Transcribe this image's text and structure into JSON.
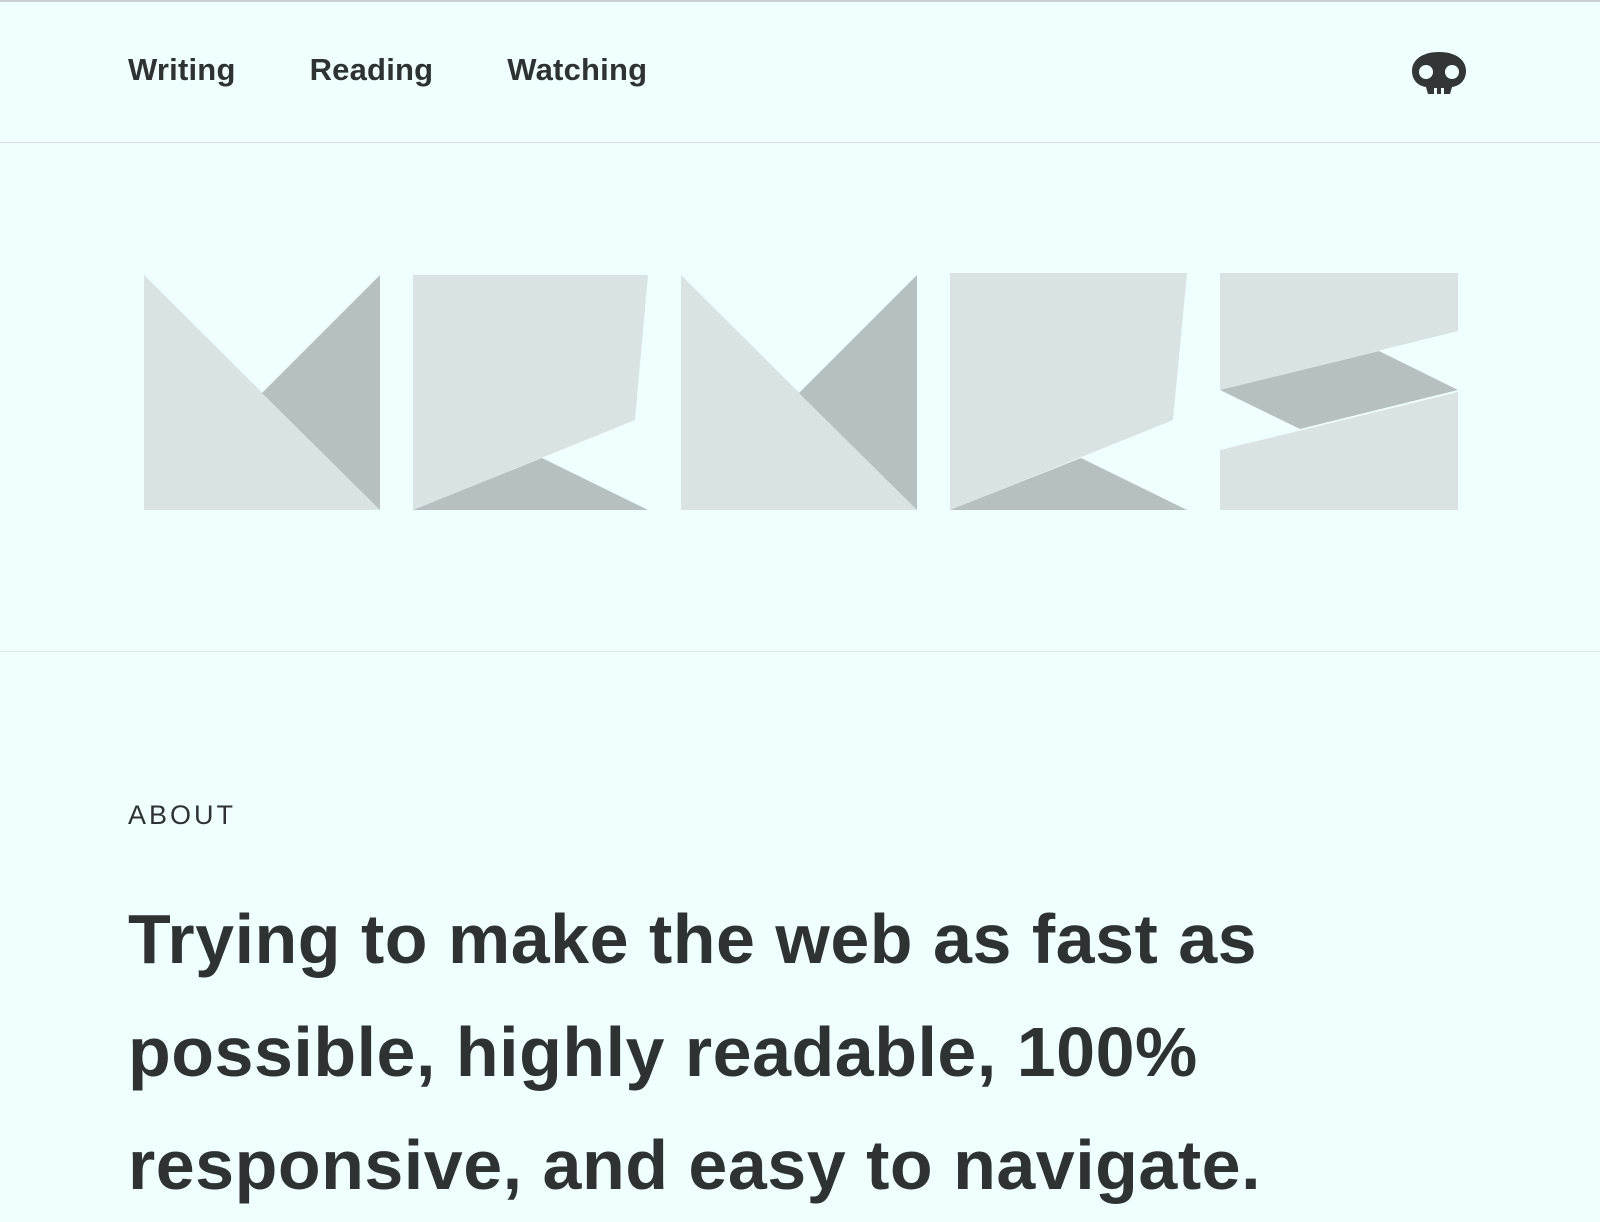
{
  "nav": {
    "links": [
      {
        "label": "Writing"
      },
      {
        "label": "Reading"
      },
      {
        "label": "Watching"
      }
    ],
    "logo_icon": "skull-icon"
  },
  "hero": {
    "art": "geometric-letter-tiles",
    "colors": {
      "light": "#d9e3e3",
      "dark": "#b6c0c0"
    }
  },
  "about": {
    "label": "ABOUT",
    "text": "Trying to make the web as fast as possible, highly readable, 100% responsive, and easy to navigate."
  },
  "colors": {
    "background": "#effffe",
    "text": "#2f3233"
  }
}
